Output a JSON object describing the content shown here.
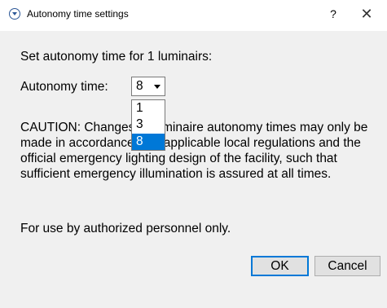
{
  "window": {
    "title": "Autonomy time settings",
    "help_label": "?",
    "close_label": "✕"
  },
  "dialog": {
    "heading": "Set autonomy time for 1 luminairs:",
    "autonomy_label": "Autonomy time:",
    "selected_value": "8",
    "options": [
      "1",
      "3",
      "8"
    ],
    "caution": "CAUTION: Changes to luminaire autonomy times may only be made in accordance with applicable local regulations and the official emergency lighting design of the facility, such that sufficient emergency illumination is assured at all times.",
    "authorized_note": "For use by authorized personnel only."
  },
  "buttons": {
    "ok_label": "OK",
    "cancel_label": "Cancel"
  },
  "colors": {
    "accent": "#0078d7",
    "dialog_bg": "#f0f0f0",
    "titlebar_bg": "#ffffff"
  }
}
